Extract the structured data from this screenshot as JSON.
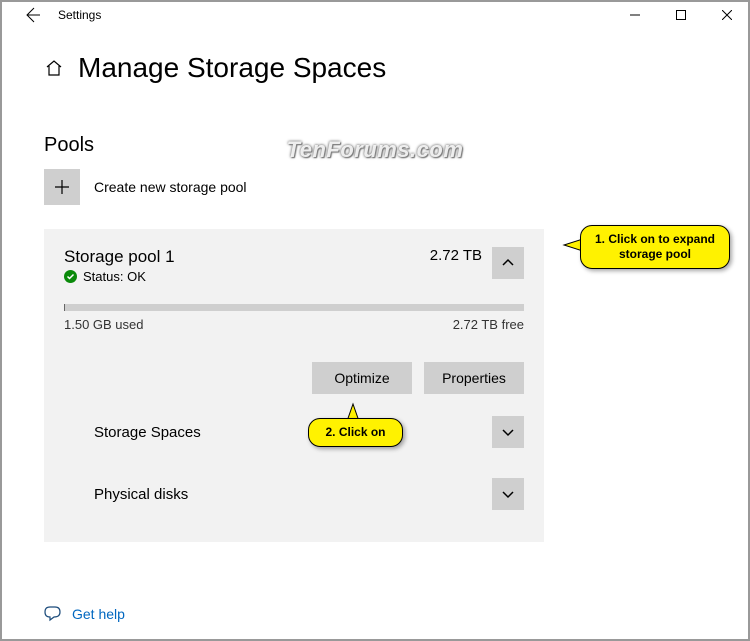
{
  "window": {
    "title": "Settings"
  },
  "page": {
    "title": "Manage Storage Spaces",
    "section": "Pools",
    "create_label": "Create new storage pool",
    "watermark": "TenForums.com"
  },
  "pool": {
    "name": "Storage pool 1",
    "status_label": "Status: OK",
    "size": "2.72 TB",
    "used_label": "1.50 GB used",
    "free_label": "2.72 TB free",
    "actions": {
      "optimize": "Optimize",
      "properties": "Properties"
    },
    "sub": {
      "spaces": "Storage Spaces",
      "disks": "Physical disks"
    }
  },
  "help": {
    "label": "Get help"
  },
  "annotations": {
    "c1": "1. Click on to expand storage pool",
    "c2": "2. Click on"
  }
}
